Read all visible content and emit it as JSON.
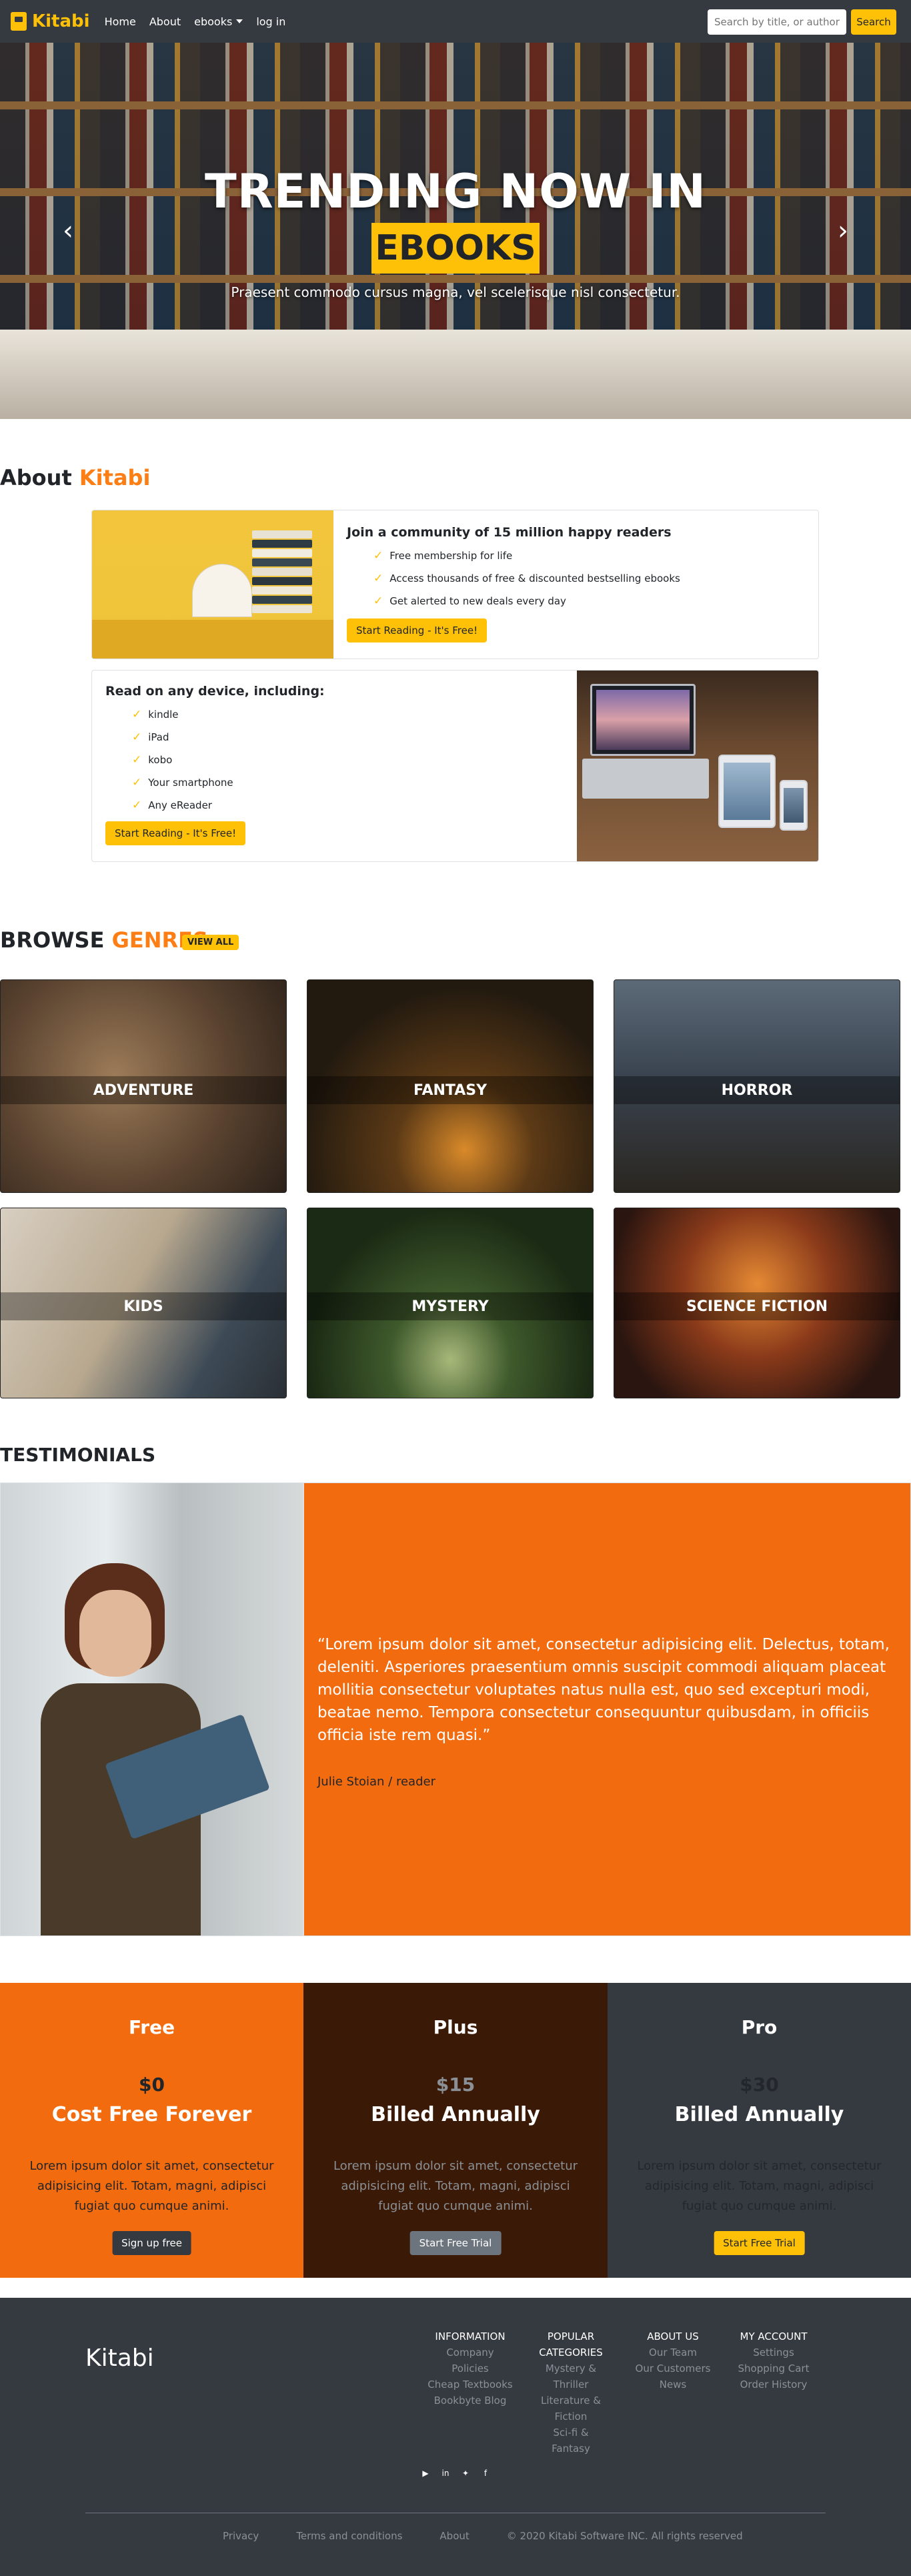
{
  "nav": {
    "brand": "Kitabi",
    "links": [
      "Home",
      "About",
      "ebooks",
      "log in"
    ],
    "search_placeholder": "Search by title, or author",
    "search_button": "Search"
  },
  "hero": {
    "title": "TRENDING NOW IN",
    "badge": "EBOOKS",
    "subtitle": "Praesent commodo cursus magna, vel scelerisque nisl consectetur."
  },
  "about": {
    "heading_prefix": "About",
    "heading_accent": "Kitabi",
    "card1": {
      "title": "Join a community of 15 million happy readers",
      "items": [
        "Free membership for life",
        "Access thousands of free & discounted bestselling ebooks",
        "Get alerted to new deals every day"
      ],
      "button": "Start Reading - It's Free!"
    },
    "card2": {
      "title": "Read on any device, including:",
      "items": [
        "kindle",
        "iPad",
        "kobo",
        "Your smartphone",
        "Any eReader"
      ],
      "button": "Start Reading - It's Free!"
    }
  },
  "genres": {
    "heading_prefix": "BROWSE",
    "heading_accent": "GENRES",
    "view_all": "VIEW ALL",
    "items": [
      "ADVENTURE",
      "FANTASY",
      "HORROR",
      "KIDS",
      "MYSTERY",
      "SCIENCE FICTION"
    ]
  },
  "testimonials": {
    "heading": "TESTIMONIALS",
    "quote": "“Lorem ipsum dolor sit amet, consectetur adipisicing elit. Delectus, totam, deleniti. Asperiores praesentium omnis suscipit commodi aliquam placeat mollitia consectetur voluptates natus nulla est, quo sed excepturi modi, beatae nemo. Tempora consectetur consequuntur quibusdam, in officiis officia iste rem quasi.”",
    "author": "Julie Stoian / reader"
  },
  "pricing": [
    {
      "name": "Free",
      "price": "$0",
      "term": "Cost Free Forever",
      "desc": "Lorem ipsum dolor sit amet, consectetur adipisicing elit. Totam, magni, adipisci fugiat quo cumque animi.",
      "button": "Sign up free"
    },
    {
      "name": "Plus",
      "price": "$15",
      "term": "Billed Annually",
      "desc": "Lorem ipsum dolor sit amet, consectetur adipisicing elit. Totam, magni, adipisci fugiat quo cumque animi.",
      "button": "Start Free Trial"
    },
    {
      "name": "Pro",
      "price": "$30",
      "term": "Billed Annually",
      "desc": "Lorem ipsum dolor sit amet, consectetur adipisicing elit. Totam, magni, adipisci fugiat quo cumque animi.",
      "button": "Start Free Trial"
    }
  ],
  "footer": {
    "brand": "Kitabi",
    "columns": [
      {
        "title": "INFORMATION",
        "links": [
          "Company",
          "Policies",
          "Cheap Textbooks",
          "Bookbyte Blog"
        ]
      },
      {
        "title": "POPULAR CATEGORIES",
        "links": [
          "Mystery &",
          "Thriller",
          "Literature &",
          "Fiction",
          "Sci-fi & Fantasy"
        ]
      },
      {
        "title": "ABOUT US",
        "links": [
          "Our Team",
          "Our Customers",
          "News"
        ]
      },
      {
        "title": "MY ACCOUNT",
        "links": [
          "Settings",
          "Shopping Cart",
          "Order History"
        ]
      }
    ],
    "bottom": [
      "Privacy",
      "Terms and conditions",
      "About",
      "© 2020 Kitabi Software INC. All rights reserved"
    ]
  },
  "colors": {
    "accent": "#ffc107",
    "orange": "#f26b0f",
    "dark": "#343a40",
    "brown": "#3a1a06"
  }
}
